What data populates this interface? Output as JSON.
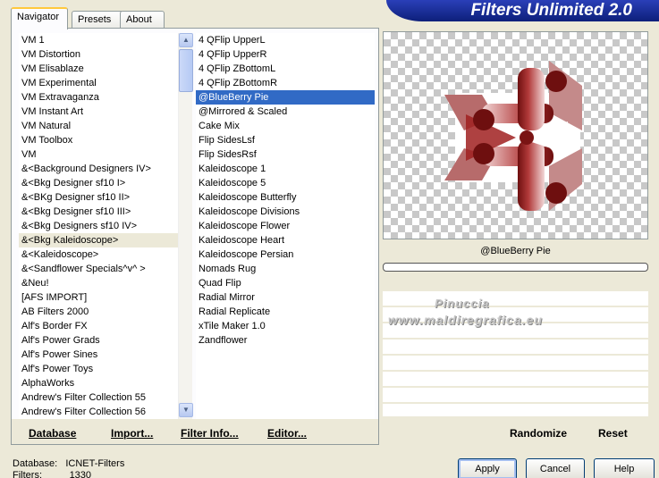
{
  "banner": {
    "title": "Filters Unlimited 2.0"
  },
  "tabs": [
    {
      "label": "Navigator"
    },
    {
      "label": "Presets"
    },
    {
      "label": "About"
    }
  ],
  "categories": {
    "items": [
      "VM 1",
      "VM Distortion",
      "VM Elisablaze",
      "VM Experimental",
      "VM Extravaganza",
      "VM Instant Art",
      "VM Natural",
      "VM Toolbox",
      "VM",
      "&<Background Designers IV>",
      "&<Bkg Designer sf10 I>",
      "&<BKg Designer sf10 II>",
      "&<Bkg Designer sf10 III>",
      "&<Bkg Designers sf10 IV>",
      "&<Bkg Kaleidoscope>",
      "&<Kaleidoscope>",
      "&<Sandflower Specials^v^ >",
      "&Neu!",
      "[AFS IMPORT]",
      "AB Filters 2000",
      "Alf's Border FX",
      "Alf's Power Grads",
      "Alf's Power Sines",
      "Alf's Power Toys",
      "AlphaWorks",
      "Andrew's Filter Collection 55",
      "Andrew's Filter Collection 56"
    ],
    "highlighted": "&<Bkg Kaleidoscope>"
  },
  "filters": {
    "items": [
      "4 QFlip UpperL",
      "4 QFlip UpperR",
      "4 QFlip ZBottomL",
      "4 QFlip ZBottomR",
      "@BlueBerry Pie",
      "@Mirrored & Scaled",
      "Cake Mix",
      "Flip SidesLsf",
      "Flip SidesRsf",
      "Kaleidoscope 1",
      "Kaleidoscope 5",
      "Kaleidoscope Butterfly",
      "Kaleidoscope Divisions",
      "Kaleidoscope Flower",
      "Kaleidoscope Heart",
      "Kaleidoscope Persian",
      "Nomads Rug",
      "Quad Flip",
      "Radial Mirror",
      "Radial Replicate",
      "xTile Maker 1.0",
      "Zandflower"
    ],
    "selected": "@BlueBerry Pie"
  },
  "bottom_links": {
    "database": "Database",
    "import": "Import...",
    "filter_info": "Filter Info...",
    "editor": "Editor..."
  },
  "preview": {
    "filter_name": "@BlueBerry Pie",
    "watermark_line1": "Pinuccia",
    "watermark_line2": "www.maldiregrafica.eu"
  },
  "right_buttons": {
    "randomize": "Randomize",
    "reset": "Reset"
  },
  "status": {
    "database_label": "Database:",
    "database_value": "ICNET-Filters",
    "filters_label": "Filters:",
    "filters_value": "1330"
  },
  "dialog_buttons": {
    "apply": "Apply",
    "cancel": "Cancel",
    "help": "Help"
  },
  "colors": {
    "accent": "#316ac5",
    "banner": "#1a2e9a",
    "artwork": "#8b1a1a"
  }
}
